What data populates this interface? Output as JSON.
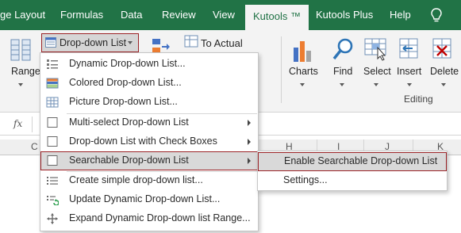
{
  "tabs": {
    "page_layout": "ge Layout",
    "formulas": "Formulas",
    "data": "Data",
    "review": "Review",
    "view": "View",
    "kutools": "Kutools ™",
    "kutools_plus": "Kutools Plus",
    "help": "Help"
  },
  "ribbon": {
    "dropdown_list": "Drop-down List",
    "to_actual": "To Actual",
    "range": "Range",
    "charts": "Charts",
    "find": "Find",
    "select": "Select",
    "insert": "Insert",
    "delete": "Delete",
    "editing_group": "Editing"
  },
  "formula_bar": {
    "fx": "fx"
  },
  "columns": [
    "C",
    "H",
    "I",
    "J",
    "K"
  ],
  "menu": {
    "items": [
      {
        "label": "Dynamic Drop-down List...",
        "icon": "dynamic-list-icon",
        "submenu": false
      },
      {
        "label": "Colored Drop-down List...",
        "icon": "colored-list-icon",
        "submenu": false
      },
      {
        "label": "Picture Drop-down List...",
        "icon": "picture-list-icon",
        "submenu": false
      },
      {
        "label": "Multi-select Drop-down List",
        "icon": "checkbox-icon",
        "submenu": true
      },
      {
        "label": "Drop-down List with Check Boxes",
        "icon": "checkbox-icon",
        "submenu": true
      },
      {
        "label": "Searchable Drop-down List",
        "icon": "checkbox-icon",
        "submenu": true,
        "highlighted": true
      },
      {
        "label": "Create simple drop-down list...",
        "icon": "list-icon",
        "submenu": false
      },
      {
        "label": "Update Dynamic Drop-down List...",
        "icon": "update-icon",
        "submenu": false
      },
      {
        "label": "Expand Dynamic Drop-down list Range...",
        "icon": "expand-icon",
        "submenu": false
      }
    ]
  },
  "submenu": {
    "items": [
      {
        "label": "Enable Searchable Drop-down List",
        "highlighted": true
      },
      {
        "label": "Settings..."
      }
    ]
  },
  "colors": {
    "tab_bar": "#217346",
    "ribbon": "#f3f3f3",
    "highlight_border": "#9b2226",
    "highlight_fill": "#d9d9d9"
  }
}
